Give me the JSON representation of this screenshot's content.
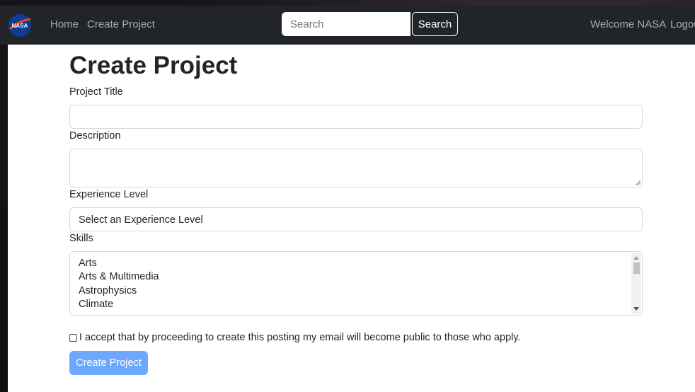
{
  "navbar": {
    "logo_text": "NASA",
    "links": [
      {
        "label": "Home"
      },
      {
        "label": "Create Project"
      }
    ],
    "search": {
      "placeholder": "Search",
      "value": "",
      "button_label": "Search"
    },
    "welcome_text": "Welcome NASA",
    "logout_label": "Logout"
  },
  "form": {
    "page_title": "Create Project",
    "title_label": "Project Title",
    "title_value": "",
    "description_label": "Description",
    "description_value": "",
    "experience_label": "Experience Level",
    "experience_selected": "Select an Experience Level",
    "skills_label": "Skills",
    "skills_options": [
      "Arts",
      "Arts & Multimedia",
      "Astrophysics",
      "Climate"
    ],
    "consent_label": "I accept that by proceeding to create this posting my email will become public to those who apply.",
    "consent_checked": false,
    "submit_label": "Create Project"
  },
  "colors": {
    "navbar_bg": "#212529",
    "primary_button_disabled": "#6ea8fe",
    "nasa_blue": "#0b3d91",
    "nasa_red": "#fc3d21"
  }
}
